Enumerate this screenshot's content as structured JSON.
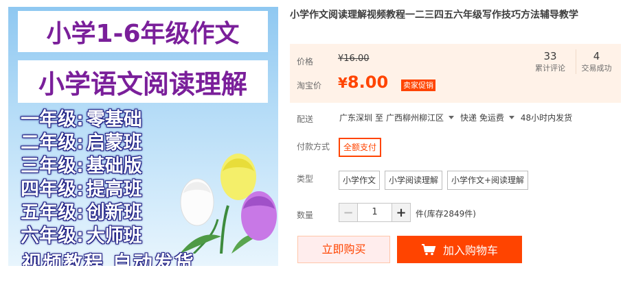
{
  "image": {
    "title_line_1": "小学1-6年级作文",
    "title_line_2": "小学语文阅读理解",
    "grades": [
      {
        "label": "一年级:",
        "value": "零基础"
      },
      {
        "label": "二年级:",
        "value": "启蒙班"
      },
      {
        "label": "三年级:",
        "value": "基础版"
      },
      {
        "label": "四年级:",
        "value": "提高班"
      },
      {
        "label": "五年级:",
        "value": "创新班"
      },
      {
        "label": "六年级:",
        "value": "大师班"
      }
    ],
    "footer": "视频教程  自动发货"
  },
  "product": {
    "title": "小学作文阅读理解视频教程一二三四五六年级写作技巧方法辅导教学"
  },
  "price": {
    "original_label": "价格",
    "original_value": "¥16.00",
    "taobao_label": "淘宝价",
    "currency": "¥",
    "amount": "8.00",
    "promo_badge": "卖家促销",
    "reviews_count": "33",
    "reviews_label": "累计评论",
    "sales_count": "4",
    "sales_label": "交易成功"
  },
  "shipping": {
    "label": "配送",
    "from": "广东深圳",
    "to_word": "至",
    "destination": "广西柳州柳江区",
    "method": "快递 免运费",
    "dispatch": "48小时内发货"
  },
  "payment": {
    "label": "付款方式",
    "option": "全额支付"
  },
  "type": {
    "label": "类型",
    "options": [
      "小学作文",
      "小学阅读理解",
      "小学作文+阅读理解"
    ]
  },
  "quantity": {
    "label": "数量",
    "minus": "−",
    "value": "1",
    "plus": "+",
    "stock": "件(库存2849件)"
  },
  "actions": {
    "buy_now": "立即购买",
    "add_to_cart": "加入购物车"
  },
  "colors": {
    "accent": "#ff4400",
    "price_bg": "#fff2e8",
    "image_title_text": "#7a1f9a"
  }
}
